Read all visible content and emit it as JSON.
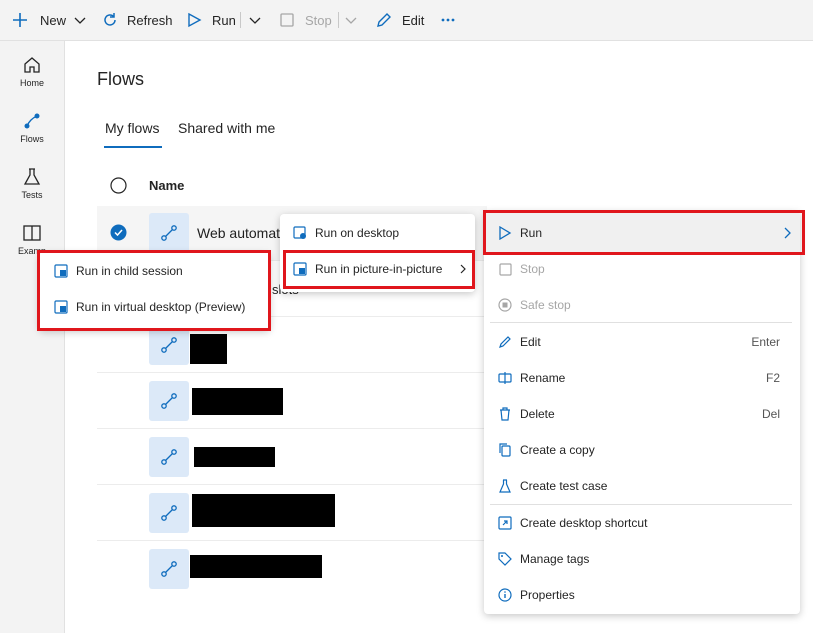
{
  "toolbar": {
    "new_label": "New",
    "refresh_label": "Refresh",
    "run_label": "Run",
    "stop_label": "Stop",
    "edit_label": "Edit"
  },
  "nav": {
    "home": "Home",
    "flows": "Flows",
    "tests": "Tests",
    "examples": "Examp"
  },
  "page": {
    "title": "Flows",
    "tabs": [
      "My flows",
      "Shared with me"
    ],
    "active_tab": "My flows",
    "column_name": "Name",
    "selected_flow": "Web automat",
    "second_row_partial": "slots"
  },
  "run_submenu": {
    "items": [
      "Run on desktop",
      "Run in picture-in-picture"
    ]
  },
  "pip_submenu": {
    "items": [
      "Run in child session",
      "Run in virtual desktop (Preview)"
    ]
  },
  "context_menu": {
    "run": "Run",
    "stop": "Stop",
    "safe_stop": "Safe stop",
    "edit": "Edit",
    "edit_shortcut": "Enter",
    "rename": "Rename",
    "rename_shortcut": "F2",
    "delete": "Delete",
    "delete_shortcut": "Del",
    "create_copy": "Create a copy",
    "create_test_case": "Create test case",
    "create_shortcut": "Create desktop shortcut",
    "manage_tags": "Manage tags",
    "properties": "Properties"
  },
  "colors": {
    "accent": "#0f6cbd",
    "highlight": "#e0161c"
  }
}
